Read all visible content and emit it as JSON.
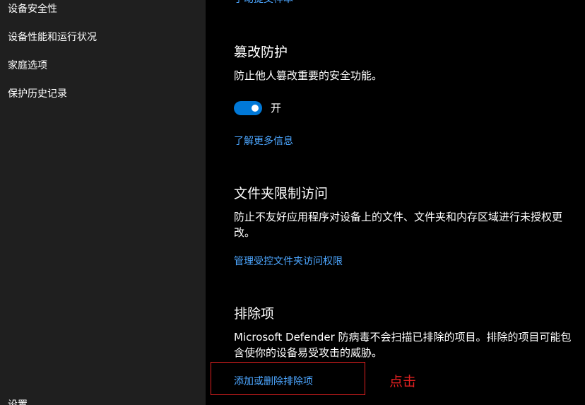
{
  "sidebar": {
    "items": [
      {
        "label": "设备安全性"
      },
      {
        "label": "设备性能和运行状况"
      },
      {
        "label": "家庭选项"
      },
      {
        "label": "保护历史记录"
      }
    ],
    "settings_label": "设置"
  },
  "main": {
    "top_link": "手动提交样本",
    "tamper": {
      "title": "篡改防护",
      "description": "防止他人篡改重要的安全功能。",
      "toggle_state": "开",
      "toggle_on": true,
      "learn_more": "了解更多信息"
    },
    "folder_access": {
      "title": "文件夹限制访问",
      "description": "防止不友好应用程序对设备上的文件、文件夹和内存区域进行未授权更改。",
      "link": "管理受控文件夹访问权限"
    },
    "exclusions": {
      "title": "排除项",
      "description": "Microsoft Defender 防病毒不会扫描已排除的项目。排除的项目可能包含使你的设备易受攻击的威胁。",
      "link": "添加或删除排除项"
    }
  },
  "annotation": {
    "text": "点击",
    "color": "#e02020"
  },
  "colors": {
    "link": "#4ca6ff",
    "toggle_on": "#0078d7",
    "sidebar_bg": "#1f1f1f",
    "main_bg": "#000000"
  }
}
